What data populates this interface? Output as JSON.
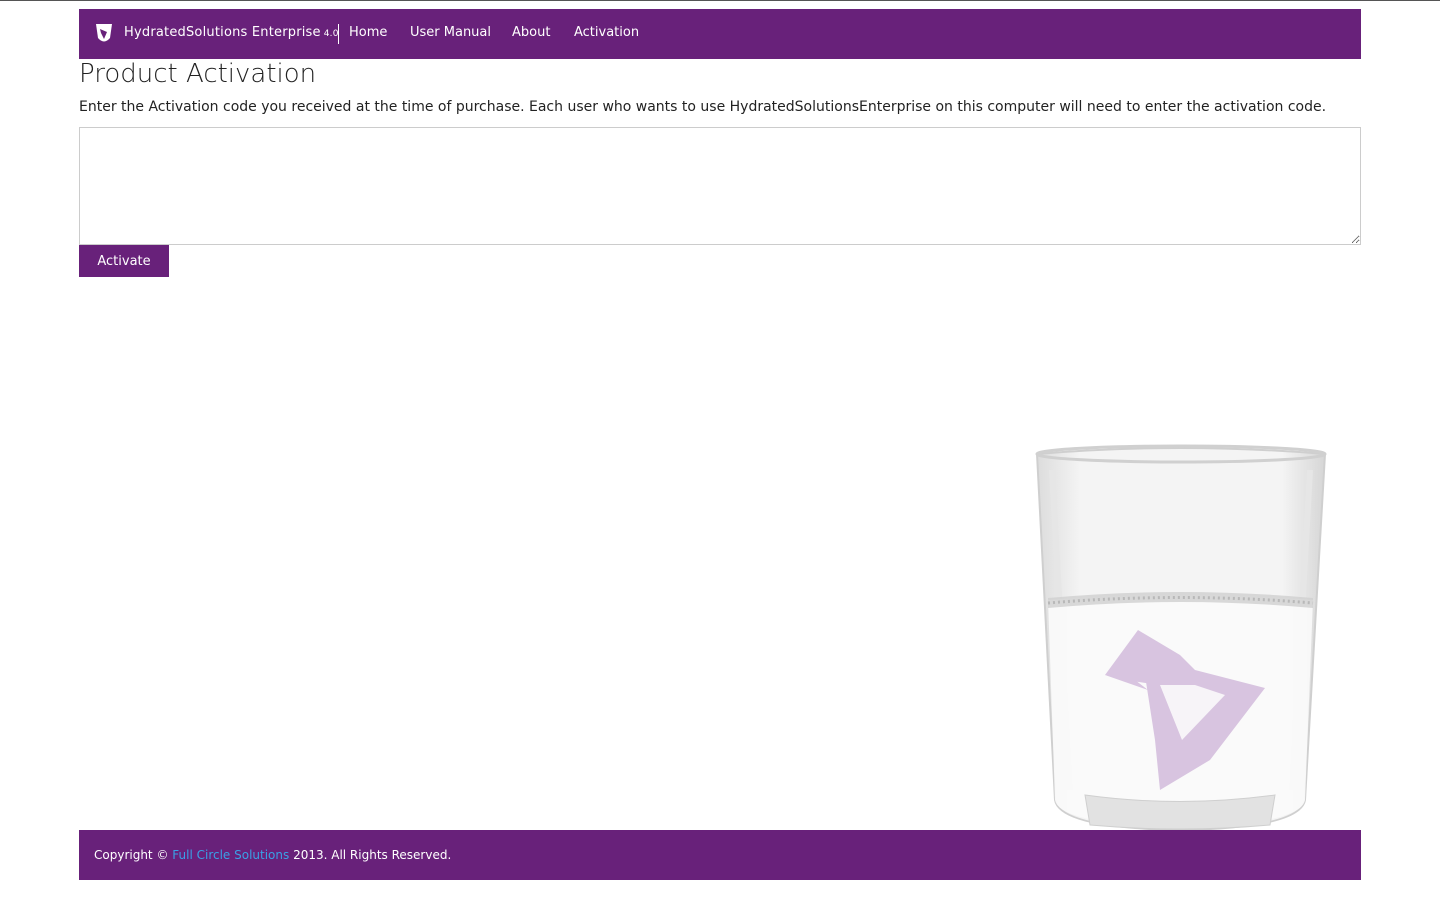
{
  "navbar": {
    "brand": "HydratedSolutions Enterprise",
    "version": "4.0",
    "links": [
      "Home",
      "User Manual",
      "About",
      "Activation"
    ]
  },
  "main": {
    "title": "Product Activation",
    "instructions": "Enter the Activation code you received at the time of purchase. Each user who wants to use HydratedSolutionsEnterprise on this computer will need to enter the activation code.",
    "activation_code_value": "",
    "activate_label": "Activate"
  },
  "footer": {
    "prefix": "Copyright © ",
    "company": "Full Circle Solutions",
    "suffix": " 2013. All Rights Reserved."
  },
  "colors": {
    "brand_purple": "#68217a",
    "footer_link": "#3aa0e6",
    "logo_tint": "#d8c4e0"
  },
  "icons": {
    "brand_logo": "visual-studio-shield-icon"
  }
}
